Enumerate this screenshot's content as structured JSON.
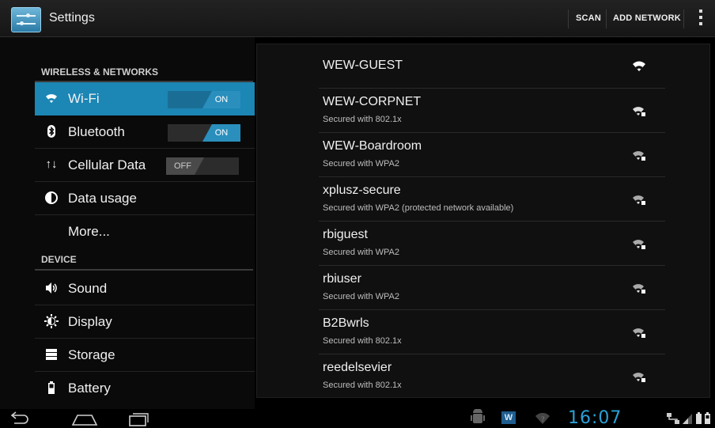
{
  "header": {
    "title": "Settings",
    "scan_label": "SCAN",
    "add_network_label": "ADD NETWORK"
  },
  "sidebar": {
    "sections": [
      {
        "title": "WIRELESS & NETWORKS",
        "items": [
          {
            "label": "Wi-Fi",
            "icon": "wifi-icon",
            "toggle": "ON",
            "selected": true
          },
          {
            "label": "Bluetooth",
            "icon": "bluetooth-icon",
            "toggle": "ON"
          },
          {
            "label": "Cellular Data",
            "icon": "cellular-data-icon",
            "toggle": "OFF"
          },
          {
            "label": "Data usage",
            "icon": "data-usage-icon"
          },
          {
            "label": "More...",
            "icon": ""
          }
        ]
      },
      {
        "title": "DEVICE",
        "items": [
          {
            "label": "Sound",
            "icon": "sound-icon"
          },
          {
            "label": "Display",
            "icon": "display-icon"
          },
          {
            "label": "Storage",
            "icon": "storage-icon"
          },
          {
            "label": "Battery",
            "icon": "battery-icon"
          }
        ]
      }
    ]
  },
  "networks": [
    {
      "ssid": "WEW-GUEST",
      "security": "",
      "secured": false
    },
    {
      "ssid": "WEW-CORPNET",
      "security": "Secured with 802.1x",
      "secured": true
    },
    {
      "ssid": "WEW-Boardroom",
      "security": "Secured with WPA2",
      "secured": true
    },
    {
      "ssid": "xplusz-secure",
      "security": "Secured with WPA2 (protected network available)",
      "secured": true
    },
    {
      "ssid": "rbiguest",
      "security": "Secured with WPA2",
      "secured": true
    },
    {
      "ssid": "rbiuser",
      "security": "Secured with WPA2",
      "secured": true
    },
    {
      "ssid": "B2Bwrls",
      "security": "Secured with 802.1x",
      "secured": true
    },
    {
      "ssid": "reedelsevier",
      "security": "Secured with 802.1x",
      "secured": true
    }
  ],
  "statusbar": {
    "time": "16:07",
    "icons": [
      "android-debug-icon",
      "w-notification-icon",
      "wifi-status-icon",
      "network-icon",
      "signal-icon",
      "battery-status-icon"
    ]
  },
  "navbar": {
    "icons": [
      "back-icon",
      "home-icon",
      "recent-apps-icon"
    ]
  },
  "colors": {
    "accent": "#1c86b4",
    "toggle_on": "#2a8fbd",
    "clock": "#2aa1d6"
  }
}
